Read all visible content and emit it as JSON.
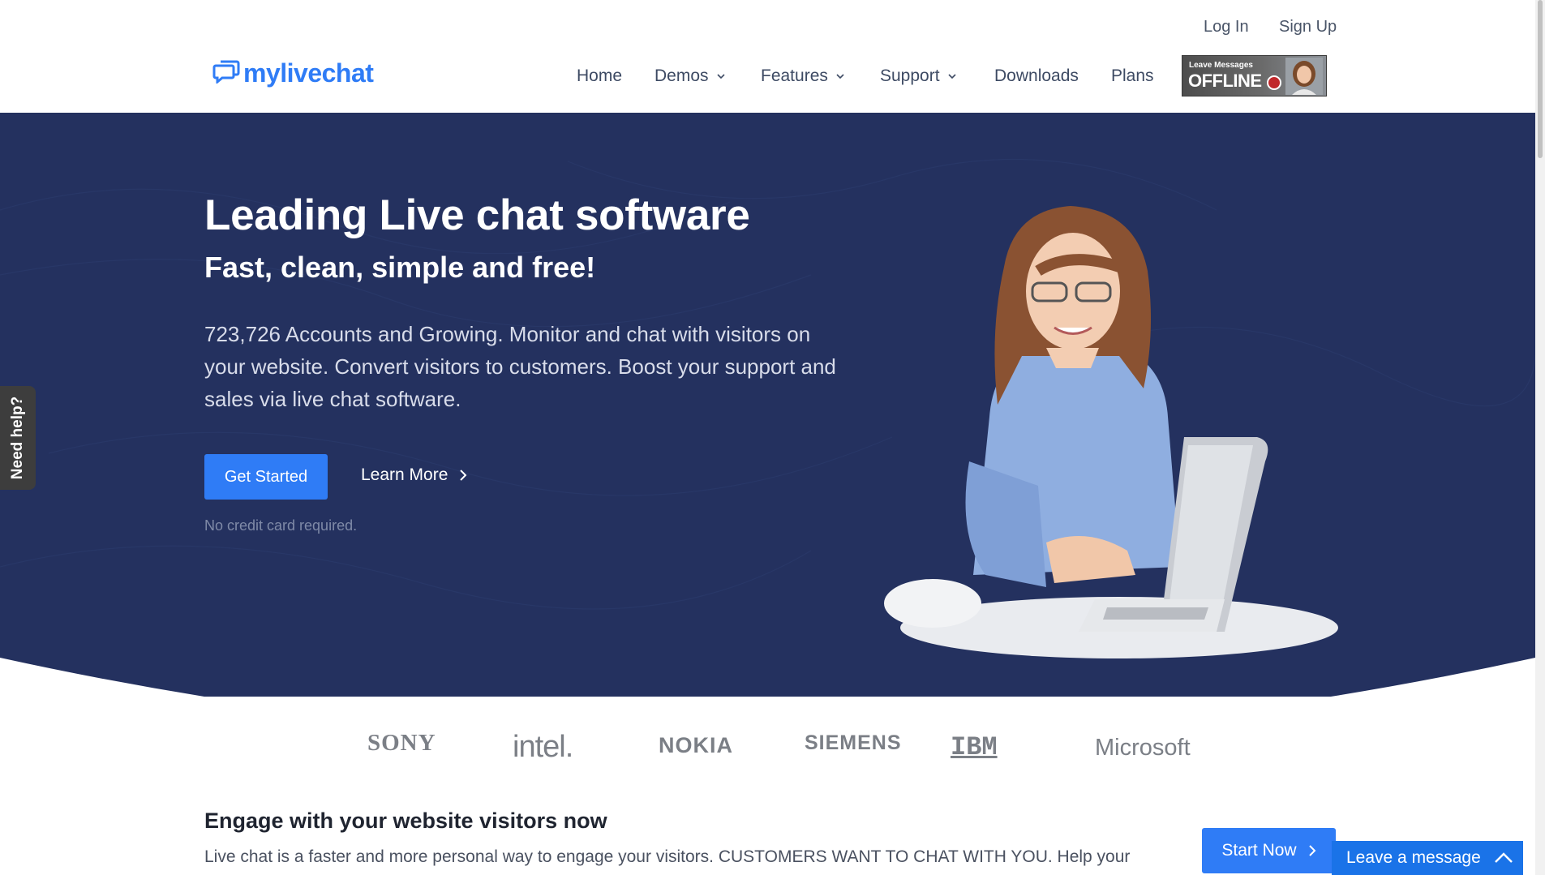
{
  "header": {
    "login": "Log In",
    "signup": "Sign Up",
    "logo_text": "mylivechat",
    "nav": [
      {
        "label": "Home"
      },
      {
        "label": "Demos"
      },
      {
        "label": "Features"
      },
      {
        "label": "Support"
      },
      {
        "label": "Downloads"
      },
      {
        "label": "Plans"
      }
    ],
    "offline_badge": {
      "small": "Leave Messages",
      "big": "OFFLINE"
    }
  },
  "hero": {
    "title": "Leading Live chat software",
    "subtitle": "Fast, clean, simple and free!",
    "description": "723,726 Accounts and Growing. Monitor and chat with visitors on your website. Convert visitors to customers. Boost your support and sales via live chat software.",
    "primary_button": "Get Started",
    "secondary_link": "Learn More",
    "note": "No credit card required."
  },
  "side_tab": "Need help?",
  "logos": [
    "SONY",
    "intel.",
    "NOKIA",
    "SIEMENS",
    "IBM",
    "Microsoft"
  ],
  "engage": {
    "title": "Engage with your website visitors now",
    "text": "Live chat is a faster and more personal way to engage your visitors. CUSTOMERS WANT TO CHAT WITH YOU. Help your",
    "button": "Start Now"
  },
  "widget": {
    "label": "Leave a message"
  },
  "colors": {
    "accent": "#2f7cf6",
    "hero_bg": "#24315f",
    "widget": "#1a73e8"
  },
  "icons": [
    "chat-bubble-icon",
    "chevron-down-icon",
    "chevron-right-icon",
    "chevron-up-icon"
  ]
}
